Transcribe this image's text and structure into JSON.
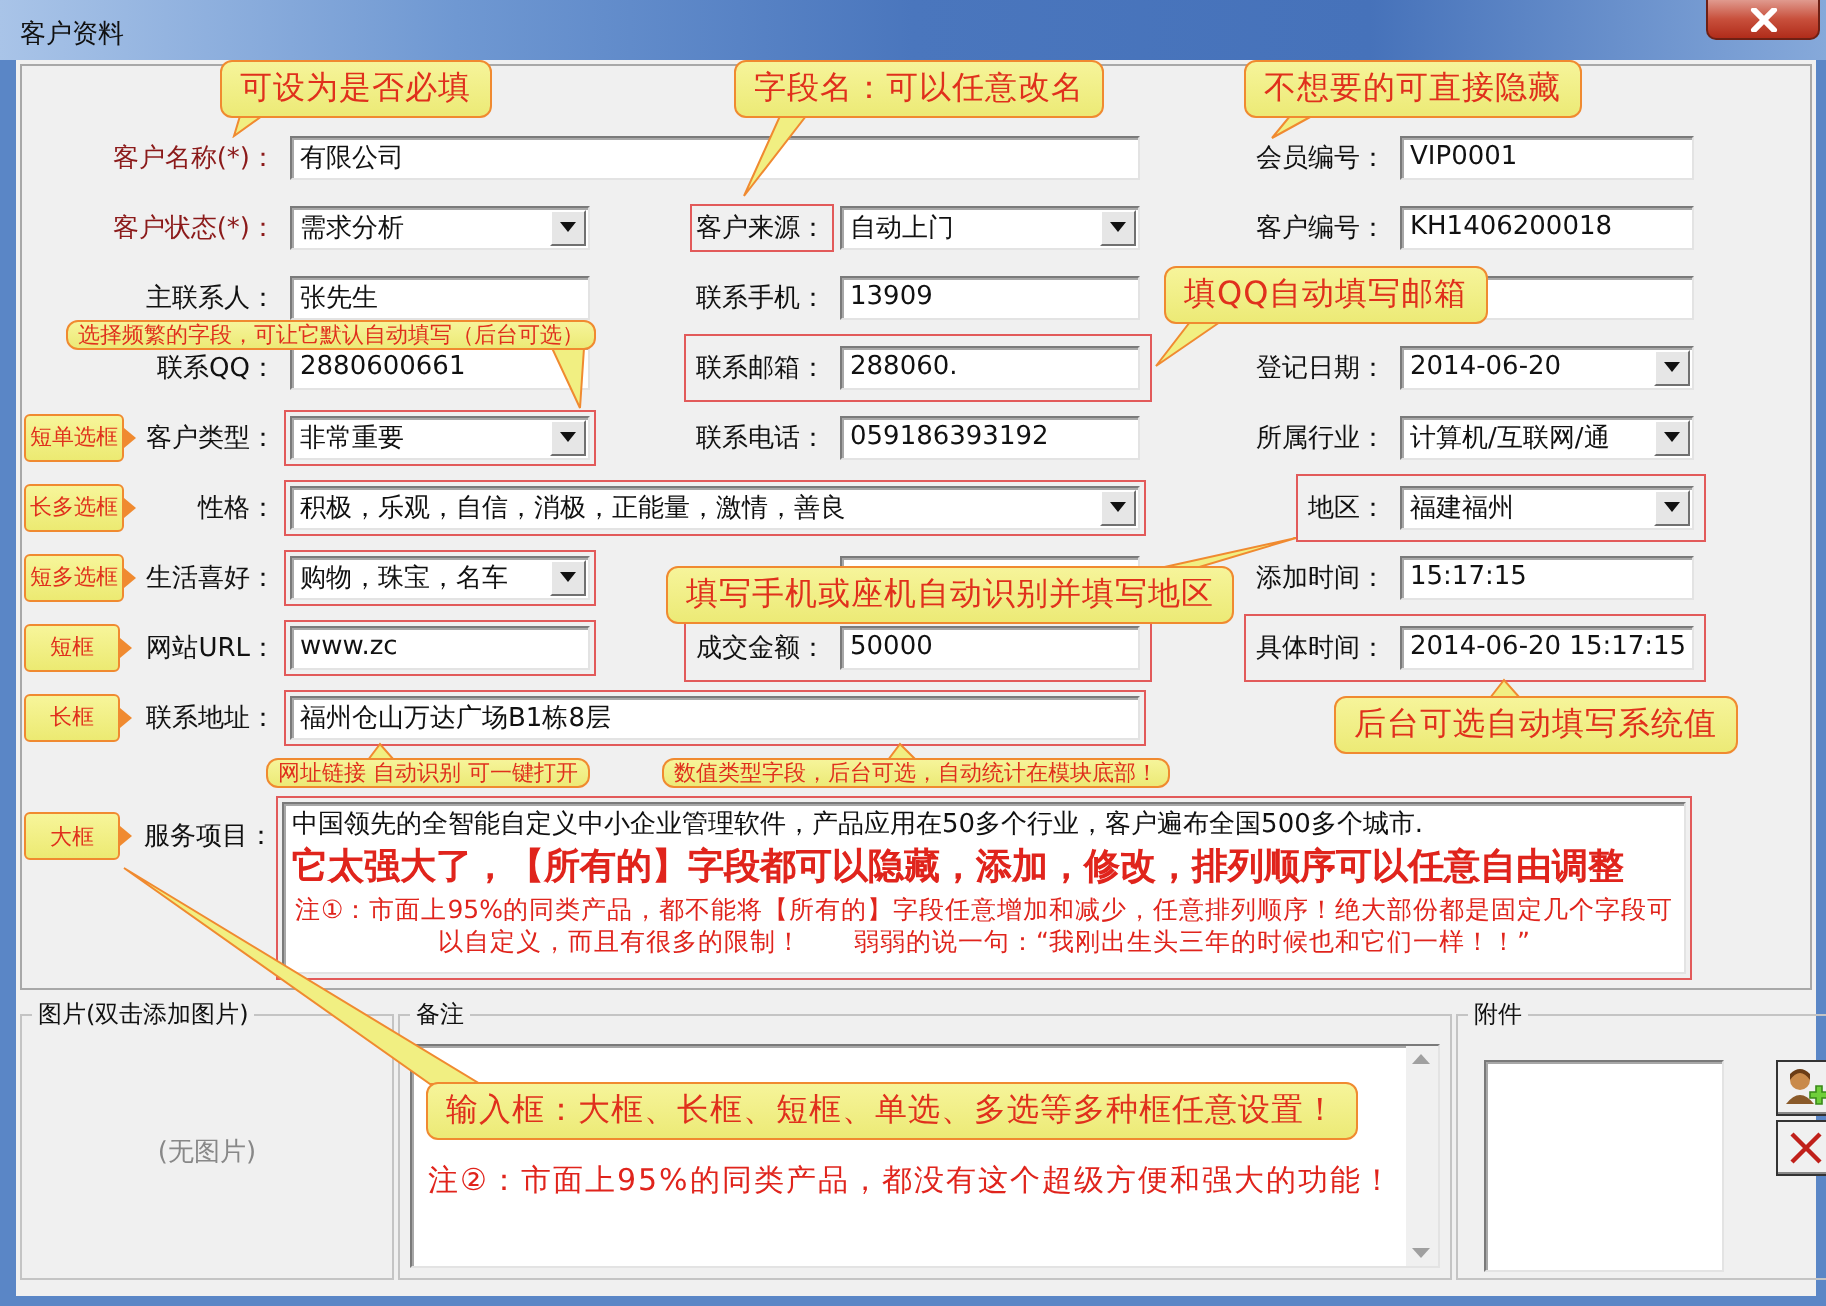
{
  "window": {
    "title": "客户资料"
  },
  "rows": [
    {
      "cells": [
        {
          "label": "客户名称(*)：",
          "required": true,
          "kind": "text",
          "long": true,
          "value": "有限公司"
        },
        {
          "label": "会员编号：",
          "required": false,
          "kind": "text",
          "value": "VIP0001"
        }
      ]
    },
    {
      "cells": [
        {
          "label": "客户状态(*)：",
          "required": true,
          "kind": "select",
          "value": "需求分析"
        },
        {
          "label": "客户来源：",
          "required": false,
          "kind": "select",
          "value": "自动上门",
          "highlight_label": true
        },
        {
          "label": "客户编号：",
          "required": false,
          "kind": "text",
          "value": "KH1406200018"
        }
      ]
    },
    {
      "cells": [
        {
          "label": "主联系人：",
          "required": false,
          "kind": "text",
          "value": "张先生"
        },
        {
          "label": "联系手机：",
          "required": false,
          "kind": "text",
          "value": "13909"
        },
        {
          "kind": "text"
        }
      ]
    },
    {
      "cells": [
        {
          "label": "联系QQ：",
          "required": false,
          "kind": "text",
          "value": "2880600661"
        },
        {
          "label": "联系邮箱：",
          "required": false,
          "kind": "text",
          "value": "288060.",
          "highlight_pair": true
        },
        {
          "label": "登记日期：",
          "required": false,
          "kind": "select",
          "value": "2014-06-20"
        }
      ]
    },
    {
      "tag": "短单选框",
      "cells": [
        {
          "label": "客户类型：",
          "required": false,
          "kind": "select",
          "value": "非常重要",
          "highlight_field": true
        },
        {
          "label": "联系电话：",
          "required": false,
          "kind": "text",
          "value": "059186393192"
        },
        {
          "label": "所属行业：",
          "required": false,
          "kind": "select",
          "value": "计算机/互联网/通"
        }
      ]
    },
    {
      "tag": "长多选框",
      "cells": [
        {
          "label": "性格：",
          "required": false,
          "kind": "select",
          "long": true,
          "value": "积极，乐观，自信，消极，正能量，激情，善良",
          "highlight_field": true
        },
        {
          "label": "地区：",
          "required": false,
          "kind": "select",
          "value": "福建福州",
          "highlight_pair": true
        }
      ]
    },
    {
      "tag": "短多选框",
      "cells": [
        {
          "label": "生活喜好：",
          "required": false,
          "kind": "select",
          "value": "购物，珠宝，名车",
          "highlight_field": true
        },
        {
          "kind": "text"
        },
        {
          "label": "添加时间：",
          "required": false,
          "kind": "text",
          "value": "15:17:15"
        }
      ]
    },
    {
      "tag": "短框",
      "cells": [
        {
          "label": "网站URL：",
          "required": false,
          "kind": "text",
          "value": "www.zc",
          "highlight_field": true
        },
        {
          "label": "成交金额：",
          "required": false,
          "kind": "text",
          "value": "50000",
          "highlight_pair": true
        },
        {
          "label": "具体时间：",
          "required": false,
          "kind": "text",
          "value": "2014-06-20 15:17:15",
          "highlight_pair": true
        }
      ]
    },
    {
      "tag": "长框",
      "cells": [
        {
          "label": "联系地址：",
          "required": false,
          "kind": "text",
          "long": true,
          "value": "福州仓山万达广场B1栋8层",
          "highlight_field": true
        }
      ]
    }
  ],
  "service": {
    "tag": "大框",
    "label": "服务项目：",
    "highlight_field": true,
    "lines": [
      {
        "kind": "plain",
        "text": "中国领先的全智能自定义中小企业管理软件，产品应用在50多个行业，客户遍布全国500多个城市."
      },
      {
        "kind": "emphasis",
        "text": "它太强大了，【所有的】字段都可以隐藏，添加，修改，排列顺序可以任意自由调整"
      },
      {
        "kind": "note",
        "text": "注①：市面上95%的同类产品，都不能将【所有的】字段任意增加和减少，任意排列顺序！绝大部份都是固定几个字段可以自定义，而且有很多的限制！　　弱弱的说一句：“我刚出生头三年的时候也和它们一样！！”"
      }
    ]
  },
  "photo": {
    "title": "图片(双击添加图片)",
    "empty_text": "(无图片)"
  },
  "notes": {
    "title": "备注",
    "lines": [
      "注②：市面上95%的同类产品，都没有这个超级方便和强大的功能！"
    ]
  },
  "attachments": {
    "title": "附件"
  },
  "callouts": [
    {
      "kind": "large",
      "text": "可设为是否必填"
    },
    {
      "kind": "large",
      "text": "字段名：可以任意改名"
    },
    {
      "kind": "large",
      "text": "不想要的可直接隐藏"
    },
    {
      "kind": "small",
      "text": "选择频繁的字段，可让它默认自动填写（后台可选）"
    },
    {
      "kind": "large",
      "text": "填QQ自动填写邮箱"
    },
    {
      "kind": "large",
      "text": "填写手机或座机自动识别并填写地区"
    },
    {
      "kind": "large",
      "text": "后台可选自动填写系统值"
    },
    {
      "kind": "small",
      "text": "网址链接 自动识别 可一键打开"
    },
    {
      "kind": "small",
      "text": "数值类型字段，后台可选，自动统计在模块底部！"
    },
    {
      "kind": "large",
      "text": "输入框：大框、长框、短框、单选、多选等多种框任意设置！"
    }
  ]
}
